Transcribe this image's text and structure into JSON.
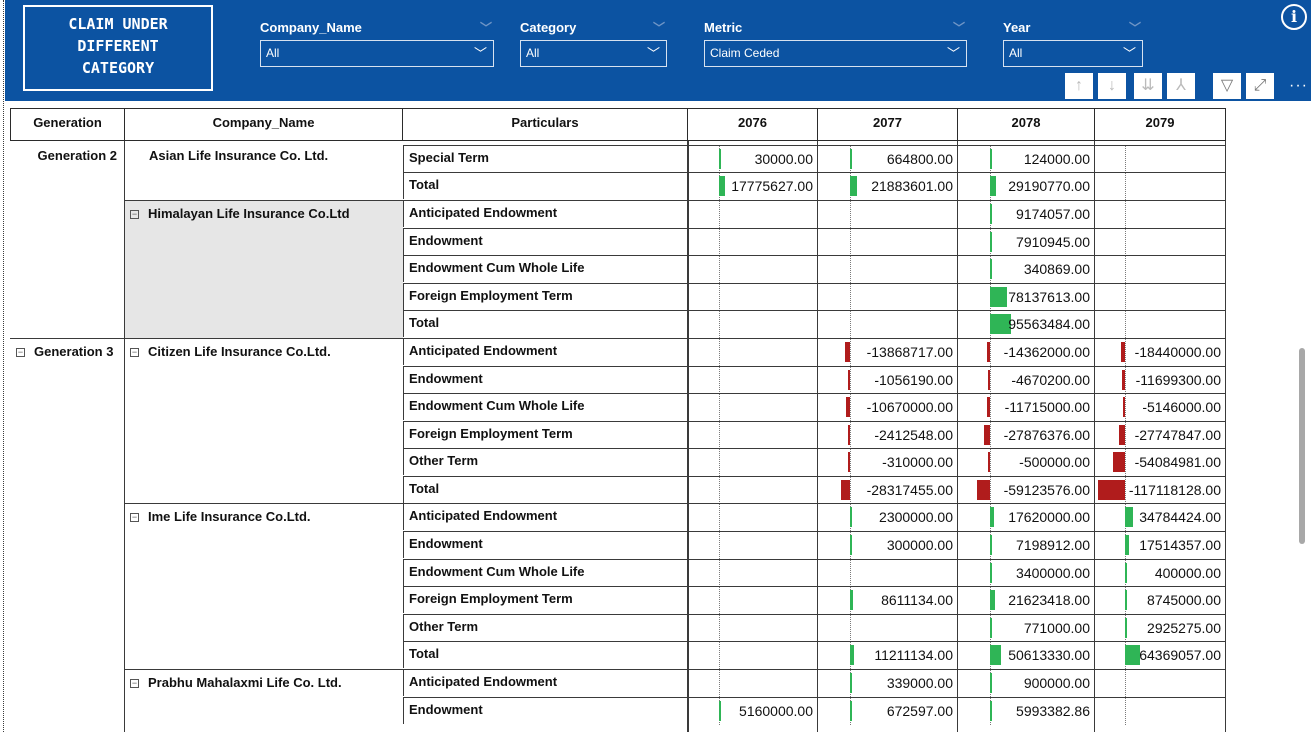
{
  "report": {
    "title": "CLAIM UNDER\nDIFFERENT\nCATEGORY",
    "info_icon": "info-icon"
  },
  "filters": [
    {
      "label": "Company_Name",
      "value": "All"
    },
    {
      "label": "Category",
      "value": "All"
    },
    {
      "label": "Metric",
      "value": "Claim Ceded"
    },
    {
      "label": "Year",
      "value": "All"
    }
  ],
  "toolbar": {
    "icons": [
      "arrow-up-icon",
      "arrow-down-icon",
      "expand-all-down-icon",
      "expand-hierarchy-icon",
      "filter-icon",
      "focus-mode-icon",
      "more-options-icon"
    ],
    "more_label": "···"
  },
  "colors": {
    "header_bg": "#0c53a2",
    "positive_bar": "#2fb556",
    "negative_bar": "#b01c1c",
    "company_highlight": "#e6e6e6"
  },
  "matrix": {
    "columns": [
      "Generation",
      "Company_Name",
      "Particulars",
      "2076",
      "2077",
      "2078",
      "2079"
    ],
    "generations": [
      {
        "label": "Generation 2"
      },
      {
        "label": "Generation 3"
      }
    ],
    "companies": [
      {
        "label": "Asian Life Insurance Co. Ltd.",
        "expandable": false
      },
      {
        "label": "Himalayan Life Insurance Co.Ltd",
        "expandable": true
      },
      {
        "label": "Citizen Life Insurance Co.Ltd.",
        "expandable": true
      },
      {
        "label": "Ime Life Insurance Co.Ltd.",
        "expandable": true
      },
      {
        "label": "Prabhu Mahalaxmi Life Co. Ltd.",
        "expandable": true
      }
    ],
    "rows": [
      {
        "particular": "Special Term",
        "values": [
          "30000.00",
          "664800.00",
          "124000.00",
          ""
        ],
        "nums": [
          30000,
          664800,
          124000,
          null
        ]
      },
      {
        "particular": "Total",
        "values": [
          "17775627.00",
          "21883601.00",
          "29190770.00",
          ""
        ],
        "nums": [
          17775627,
          21883601,
          29190770,
          null
        ]
      },
      {
        "particular": "Anticipated Endowment",
        "values": [
          "",
          "",
          "9174057.00",
          ""
        ],
        "nums": [
          null,
          null,
          9174057,
          null
        ]
      },
      {
        "particular": "Endowment",
        "values": [
          "",
          "",
          "7910945.00",
          ""
        ],
        "nums": [
          null,
          null,
          7910945,
          null
        ]
      },
      {
        "particular": "Endowment Cum Whole Life",
        "values": [
          "",
          "",
          "340869.00",
          ""
        ],
        "nums": [
          null,
          null,
          340869,
          null
        ]
      },
      {
        "particular": "Foreign Employment Term",
        "values": [
          "",
          "",
          "78137613.00",
          ""
        ],
        "nums": [
          null,
          null,
          78137613,
          null
        ]
      },
      {
        "particular": "Total",
        "values": [
          "",
          "",
          "95563484.00",
          ""
        ],
        "nums": [
          null,
          null,
          95563484,
          null
        ]
      },
      {
        "particular": "Anticipated Endowment",
        "values": [
          "",
          "-13868717.00",
          "-14362000.00",
          "-18440000.00"
        ],
        "nums": [
          null,
          -13868717,
          -14362000,
          -18440000
        ]
      },
      {
        "particular": "Endowment",
        "values": [
          "",
          "-1056190.00",
          "-4670200.00",
          "-11699300.00"
        ],
        "nums": [
          null,
          -1056190,
          -4670200,
          -11699300
        ]
      },
      {
        "particular": "Endowment Cum Whole Life",
        "values": [
          "",
          "-10670000.00",
          "-11715000.00",
          "-5146000.00"
        ],
        "nums": [
          null,
          -10670000,
          -11715000,
          -5146000
        ]
      },
      {
        "particular": "Foreign Employment Term",
        "values": [
          "",
          "-2412548.00",
          "-27876376.00",
          "-27747847.00"
        ],
        "nums": [
          null,
          -2412548,
          -27876376,
          -27747847
        ]
      },
      {
        "particular": "Other Term",
        "values": [
          "",
          "-310000.00",
          "-500000.00",
          "-54084981.00"
        ],
        "nums": [
          null,
          -310000,
          -500000,
          -54084981
        ]
      },
      {
        "particular": "Total",
        "values": [
          "",
          "-28317455.00",
          "-59123576.00",
          "-117118128.00"
        ],
        "nums": [
          null,
          -28317455,
          -59123576,
          -117118128
        ]
      },
      {
        "particular": "Anticipated Endowment",
        "values": [
          "",
          "2300000.00",
          "17620000.00",
          "34784424.00"
        ],
        "nums": [
          null,
          2300000,
          17620000,
          34784424
        ]
      },
      {
        "particular": "Endowment",
        "values": [
          "",
          "300000.00",
          "7198912.00",
          "17514357.00"
        ],
        "nums": [
          null,
          300000,
          7198912,
          17514357
        ]
      },
      {
        "particular": "Endowment Cum Whole Life",
        "values": [
          "",
          "",
          "3400000.00",
          "400000.00"
        ],
        "nums": [
          null,
          null,
          3400000,
          400000
        ]
      },
      {
        "particular": "Foreign Employment Term",
        "values": [
          "",
          "8611134.00",
          "21623418.00",
          "8745000.00"
        ],
        "nums": [
          null,
          8611134,
          21623418,
          8745000
        ]
      },
      {
        "particular": "Other Term",
        "values": [
          "",
          "",
          "771000.00",
          "2925275.00"
        ],
        "nums": [
          null,
          null,
          771000,
          2925275
        ]
      },
      {
        "particular": "Total",
        "values": [
          "",
          "11211134.00",
          "50613330.00",
          "64369057.00"
        ],
        "nums": [
          null,
          11211134,
          50613330,
          64369057
        ]
      },
      {
        "particular": "Anticipated Endowment",
        "values": [
          "",
          "339000.00",
          "900000.00",
          ""
        ],
        "nums": [
          null,
          339000,
          900000,
          null
        ]
      },
      {
        "particular": "Endowment",
        "values": [
          "5160000.00",
          "672597.00",
          "5993382.86",
          ""
        ],
        "nums": [
          5160000,
          672597,
          5993382.86,
          null
        ]
      }
    ]
  }
}
